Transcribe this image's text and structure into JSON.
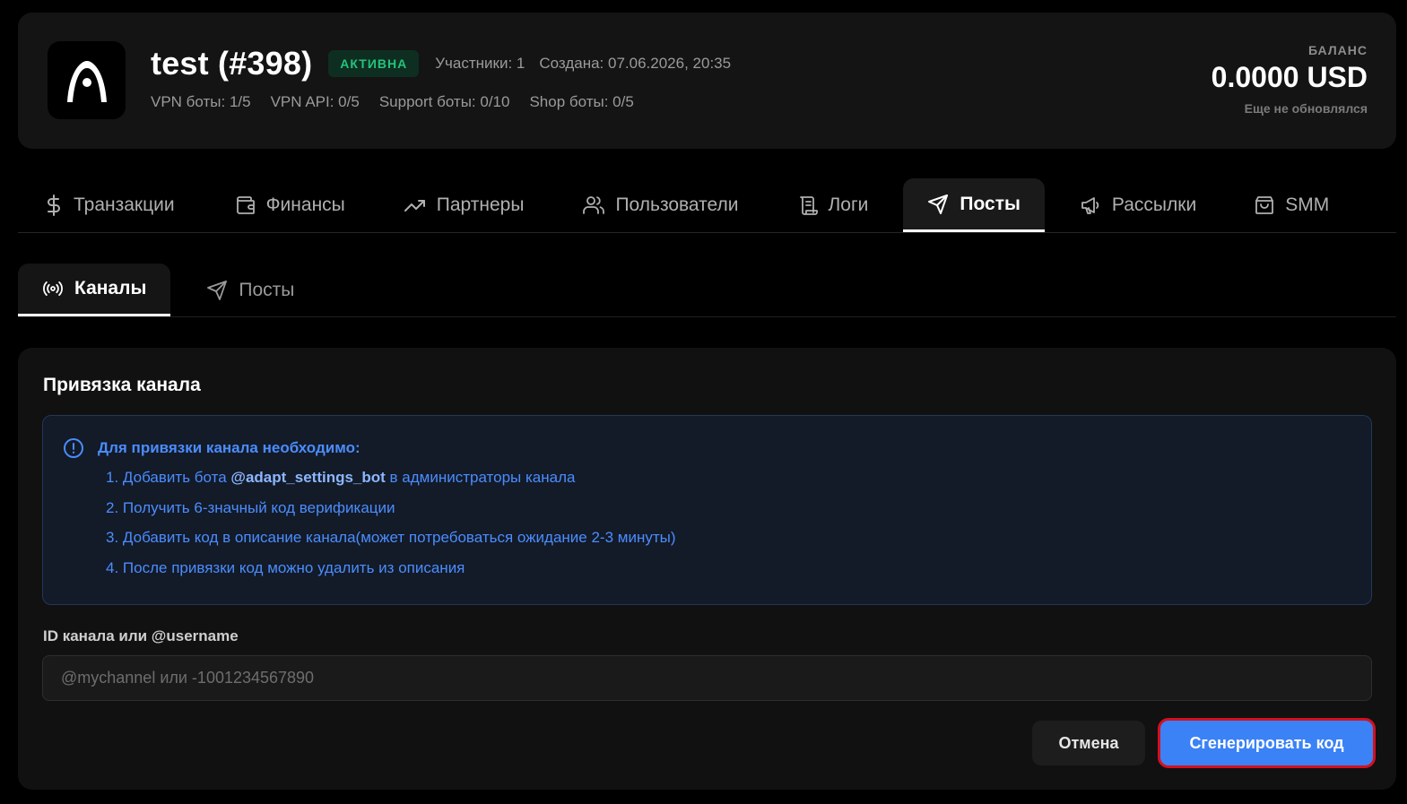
{
  "header": {
    "title": "test (#398)",
    "status_badge": "АКТИВНА",
    "members": "Участники: 1",
    "created": "Создана: 07.06.2026, 20:35",
    "limits": [
      "VPN боты: 1/5",
      "VPN API: 0/5",
      "Support боты: 0/10",
      "Shop боты: 0/5"
    ],
    "balance": {
      "label": "БАЛАНС",
      "value": "0.0000 USD",
      "note": "Еще не обновлялся"
    }
  },
  "main_tabs": [
    {
      "label": "Транзакции",
      "icon": "dollar-icon"
    },
    {
      "label": "Финансы",
      "icon": "wallet-icon"
    },
    {
      "label": "Партнеры",
      "icon": "trending-up-icon"
    },
    {
      "label": "Пользователи",
      "icon": "users-icon"
    },
    {
      "label": "Логи",
      "icon": "scroll-icon"
    },
    {
      "label": "Посты",
      "icon": "send-icon",
      "active": true
    },
    {
      "label": "Рассылки",
      "icon": "megaphone-icon"
    },
    {
      "label": "SMM",
      "icon": "shopping-bag-icon"
    }
  ],
  "sub_tabs": [
    {
      "label": "Каналы",
      "icon": "radio-icon",
      "active": true
    },
    {
      "label": "Посты",
      "icon": "send-icon"
    }
  ],
  "channel_binding": {
    "title": "Привязка канала",
    "info": {
      "heading": "Для привязки канала необходимо:",
      "steps": [
        {
          "number": "1.",
          "before": "Добавить бота ",
          "bold": "@adapt_settings_bot",
          "after": " в администраторы канала"
        },
        {
          "number": "2.",
          "text": "Получить 6-значный код верификации"
        },
        {
          "number": "3.",
          "text": "Добавить код в описание канала(может потребоваться ожидание 2-3 минуты)"
        },
        {
          "number": "4.",
          "text": "После привязки код можно удалить из описания"
        }
      ]
    },
    "field_label": "ID канала или @username",
    "field_placeholder": "@mychannel или -1001234567890",
    "field_value": "",
    "cancel_label": "Отмена",
    "generate_label": "Сгенерировать код"
  },
  "colors": {
    "accent": "#3b82f6",
    "info_text": "#4a8dfd",
    "badge_text": "#22c47a",
    "highlight_border": "#d4101f"
  }
}
